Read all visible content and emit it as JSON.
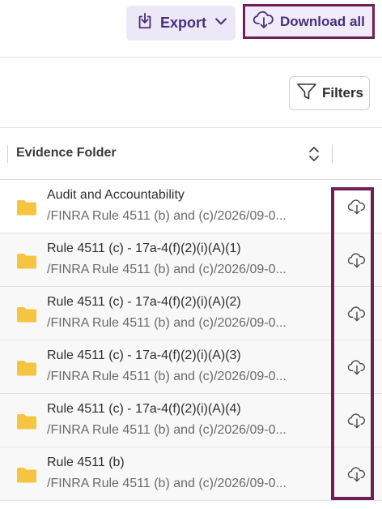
{
  "toolbar": {
    "export_label": "Export",
    "download_all_label": "Download all"
  },
  "filters": {
    "label": "Filters"
  },
  "table": {
    "column_header": "Evidence Folder",
    "rows": [
      {
        "title": "Audit and Accountability",
        "path": "/FINRA Rule 4511 (b) and (c)/2026/09-0..."
      },
      {
        "title": "Rule 4511 (c) - 17a-4(f)(2)(i)(A)(1)",
        "path": "/FINRA Rule 4511 (b) and (c)/2026/09-0..."
      },
      {
        "title": "Rule 4511 (c) - 17a-4(f)(2)(i)(A)(2)",
        "path": "/FINRA Rule 4511 (b) and (c)/2026/09-0..."
      },
      {
        "title": "Rule 4511 (c) - 17a-4(f)(2)(i)(A)(3)",
        "path": "/FINRA Rule 4511 (b) and (c)/2026/09-0..."
      },
      {
        "title": "Rule 4511 (c) - 17a-4(f)(2)(i)(A)(4)",
        "path": "/FINRA Rule 4511 (b) and (c)/2026/09-0..."
      },
      {
        "title": "Rule 4511 (b)",
        "path": "/FINRA Rule 4511 (b) and (c)/2026/09-0..."
      }
    ]
  },
  "colors": {
    "accent": "#4a2f7a",
    "highlight": "#6e1f56",
    "folder": "#f5c542"
  },
  "icons": [
    "export-icon",
    "chevron-down-icon",
    "cloud-download-icon",
    "filter-icon",
    "sort-icon",
    "folder-icon"
  ]
}
